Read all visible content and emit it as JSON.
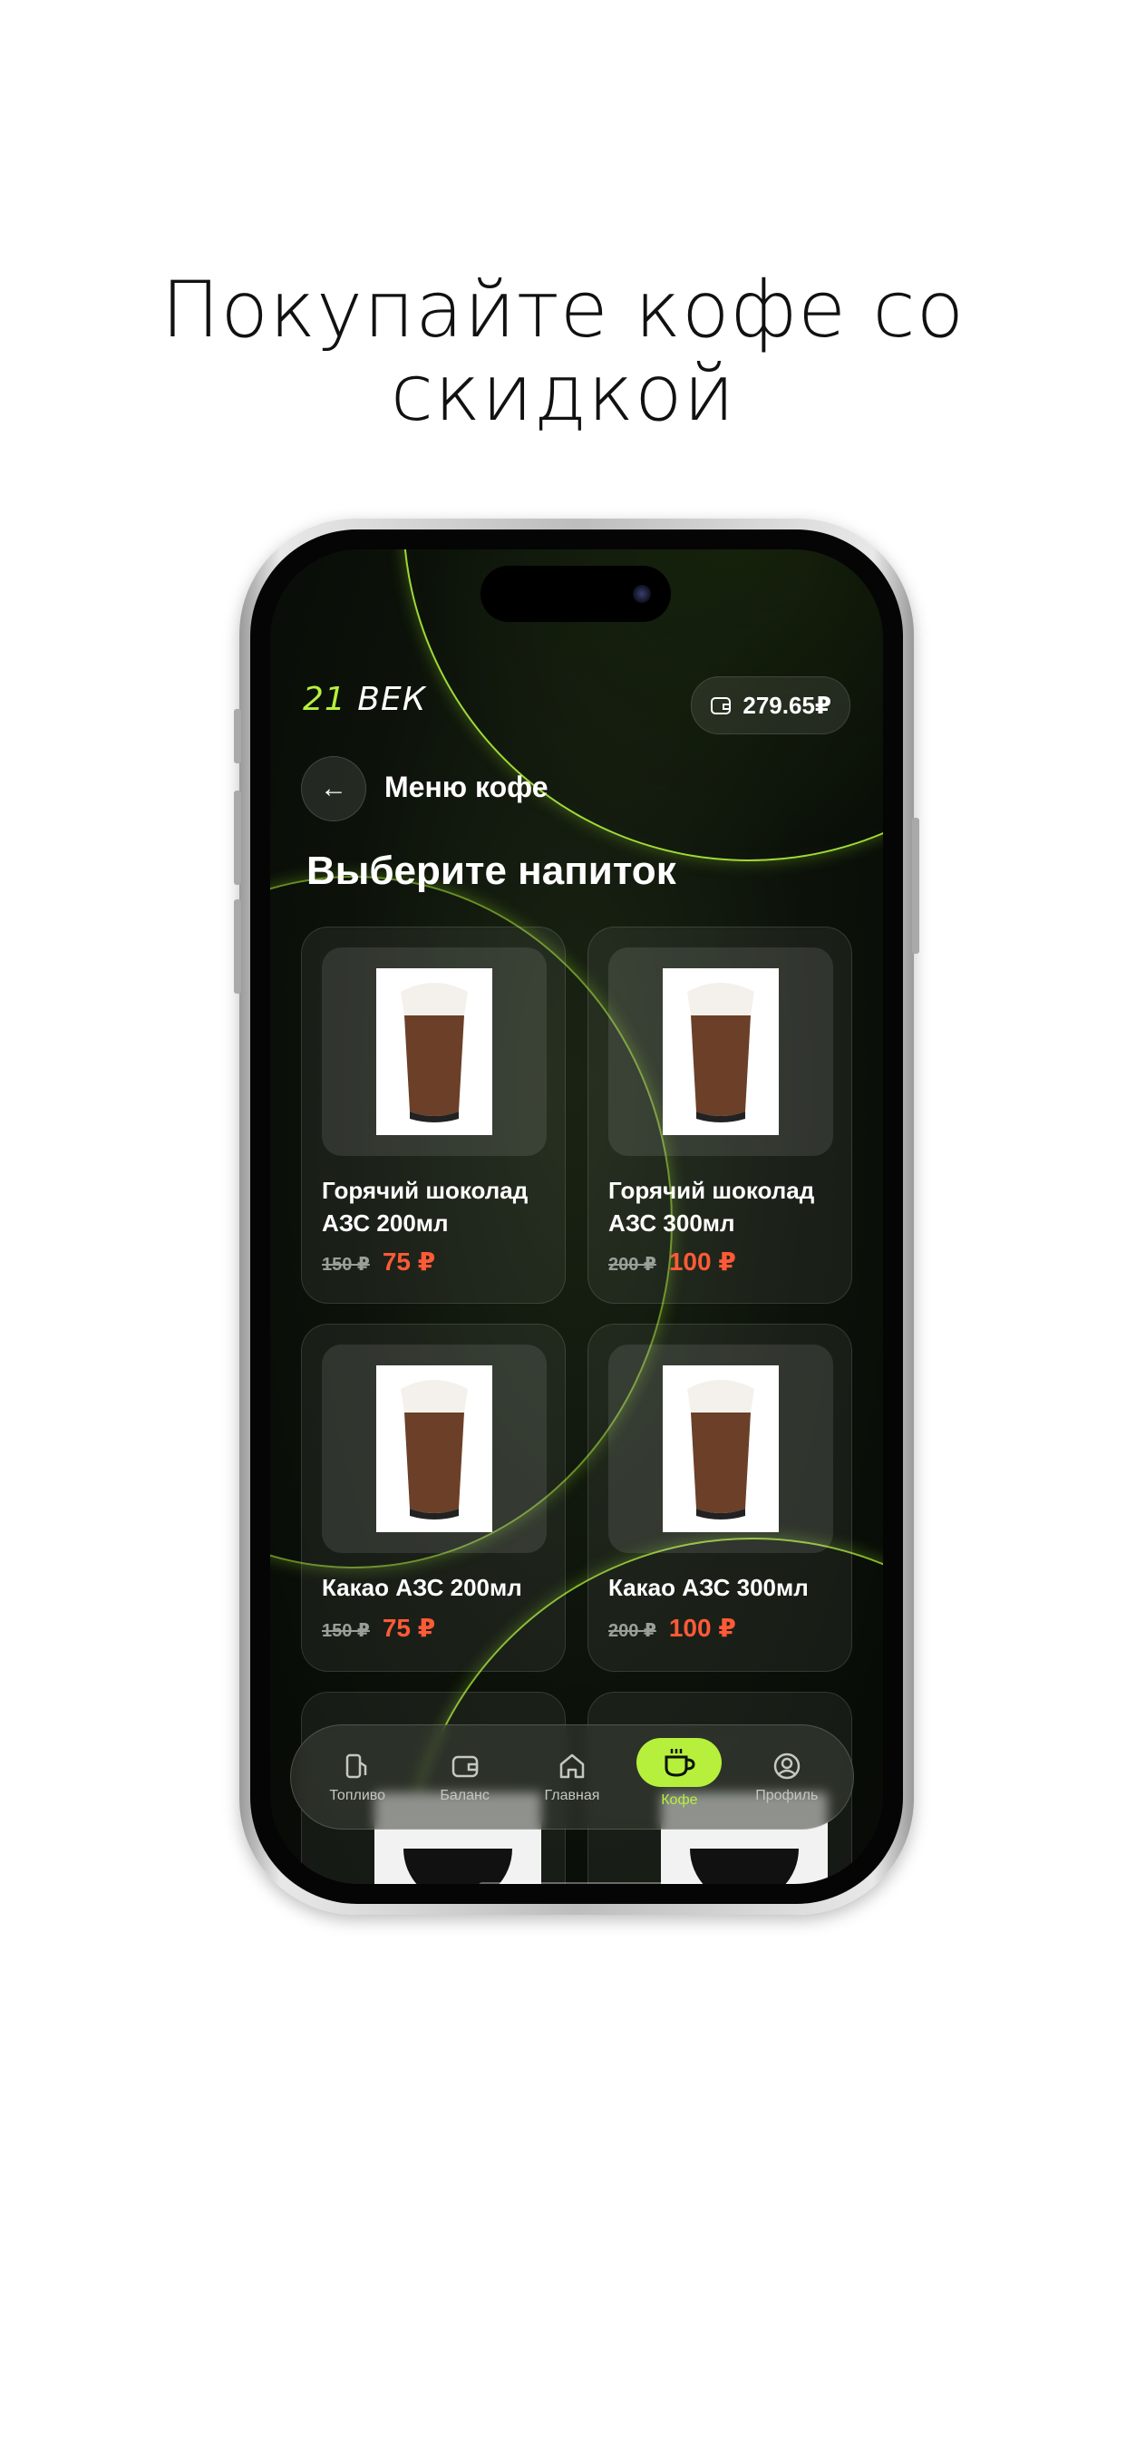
{
  "headline": {
    "line1": "Покупайте кофе со",
    "line2": "скидкой"
  },
  "app": {
    "logo_num": "21",
    "logo_word": "ВЕК",
    "balance": "279.65₽",
    "back_icon": "arrow-left-icon",
    "screen_title": "Меню кофе",
    "section_title": "Выберите напиток"
  },
  "products": [
    {
      "name": "Горячий шоколад АЗС 200мл",
      "old_price": "150 ₽",
      "price": "75 ₽"
    },
    {
      "name": "Горячий шоколад АЗС 300мл",
      "old_price": "200 ₽",
      "price": "100 ₽"
    },
    {
      "name": "Какао АЗС 200мл",
      "old_price": "150 ₽",
      "price": "75 ₽"
    },
    {
      "name": "Какао АЗС 300мл",
      "old_price": "200 ₽",
      "price": "100 ₽"
    }
  ],
  "tabbar": {
    "tabs": [
      {
        "label": "Топливо",
        "icon": "fuel-icon"
      },
      {
        "label": "Баланс",
        "icon": "wallet-icon"
      },
      {
        "label": "Главная",
        "icon": "home-icon"
      },
      {
        "label": "Кофе",
        "icon": "coffee-cup-icon",
        "active": true
      },
      {
        "label": "Профиль",
        "icon": "profile-icon"
      }
    ]
  },
  "colors": {
    "accent": "#b6f03c",
    "discount_price": "#ff5a36",
    "background_dark": "#0c120a"
  }
}
